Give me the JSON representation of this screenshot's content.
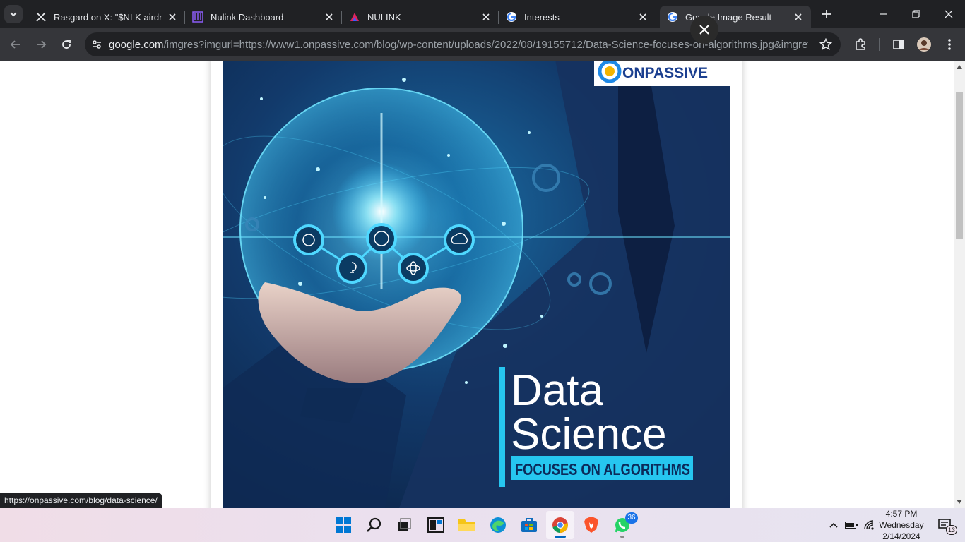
{
  "tabs": [
    {
      "title": "Rasgard on X: \"$NLK airdrop",
      "icon": "x-logo-icon"
    },
    {
      "title": "Nulink Dashboard",
      "icon": "nulink-icon"
    },
    {
      "title": "NULINK",
      "icon": "nulink-icon"
    },
    {
      "title": "Interests",
      "icon": "google-icon"
    },
    {
      "title": "Google Image Result",
      "icon": "google-icon",
      "active": true
    }
  ],
  "address_bar": {
    "host": "google.com",
    "path": "/imgres?imgurl=https://www1.onpassive.com/blog/wp-content/uploads/2022/08/19155712/Data-Science-focuses-on-algorithms.jpg&imgrefurl=ht..."
  },
  "image": {
    "brand": "ONPASSIVE",
    "headline_line1": "Data",
    "headline_line2": "Science",
    "tagline": "FOCUSES ON ALGORITHMS"
  },
  "status_bar": {
    "link": "https://onpassive.com/blog/data-science/"
  },
  "taskbar": {
    "apps": [
      "windows-start",
      "search",
      "task-view",
      "widgets",
      "file-explorer",
      "edge",
      "microsoft-store",
      "chrome",
      "brave",
      "whatsapp"
    ],
    "whatsapp_badge": "36",
    "time": "4:57 PM",
    "day": "Wednesday",
    "date": "2/14/2024",
    "notifications": "13"
  },
  "colors": {
    "chrome_dark": "#202124",
    "chrome_toolbar": "#35363a",
    "accent_cyan": "#4fd8ff",
    "tagline_bg": "#26c6f0"
  }
}
